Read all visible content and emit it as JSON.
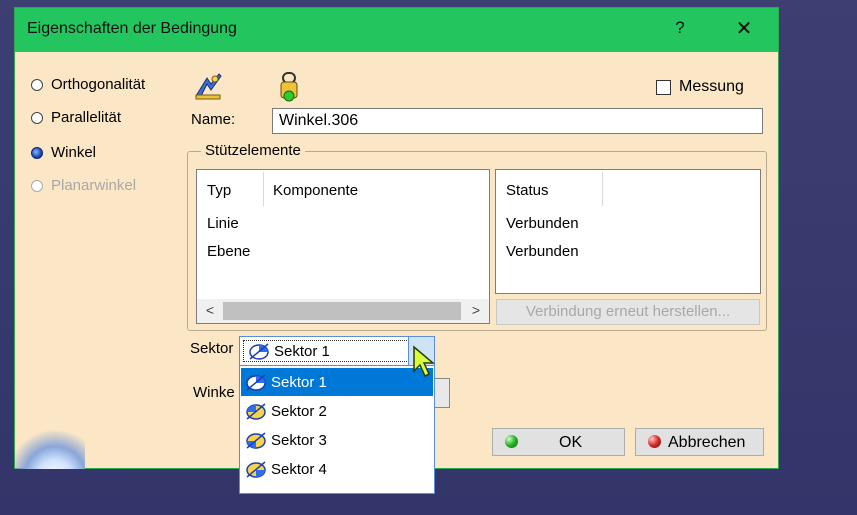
{
  "window": {
    "title": "Eigenschaften der Bedingung",
    "help_label": "?",
    "close_label": "✕"
  },
  "constraint_types": [
    {
      "label": "Orthogonalität",
      "selected": false,
      "enabled": true
    },
    {
      "label": "Parallelität",
      "selected": false,
      "enabled": true
    },
    {
      "label": "Winkel",
      "selected": true,
      "enabled": true
    },
    {
      "label": "Planarwinkel",
      "selected": false,
      "enabled": false
    }
  ],
  "measure": {
    "label": "Messung",
    "checked": false
  },
  "name": {
    "label": "Name:",
    "value": "Winkel.306"
  },
  "support": {
    "group_title": "Stützelemente",
    "columns": [
      "Typ",
      "Komponente"
    ],
    "status_header": "Status",
    "rows": [
      {
        "typ": "Linie",
        "komponente": "",
        "status": "Verbunden"
      },
      {
        "typ": "Ebene",
        "komponente": "",
        "status": "Verbunden"
      }
    ],
    "scroll_left": "<",
    "scroll_right": ">",
    "reconnect_label": "Verbindung erneut herstellen..."
  },
  "sektor": {
    "label": "Sektor",
    "value": "Sektor 1",
    "options": [
      "Sektor 1",
      "Sektor 2",
      "Sektor 3",
      "Sektor 4"
    ],
    "highlighted_index": 0
  },
  "winkel": {
    "label": "Winke"
  },
  "buttons": {
    "ok": "OK",
    "cancel": "Abbrechen"
  },
  "colors": {
    "titlebar": "#22c55e",
    "dialog_bg": "#fbe7c6",
    "selection": "#0078d7"
  }
}
